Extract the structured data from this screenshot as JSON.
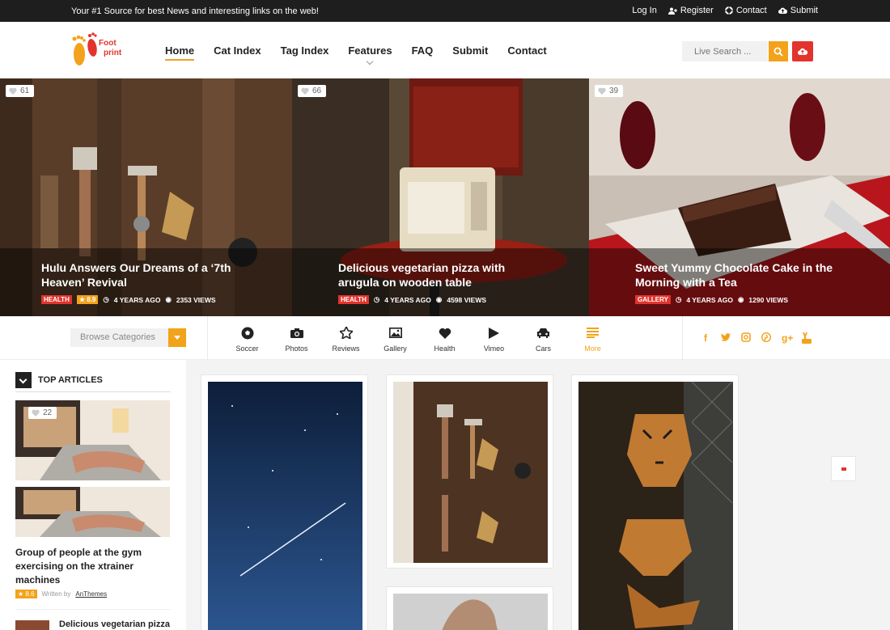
{
  "topbar": {
    "tagline": "Your #1 Source for best News and interesting links on the web!",
    "links": [
      {
        "label": "Log In",
        "icon": ""
      },
      {
        "label": "Register",
        "icon": "user-plus-icon"
      },
      {
        "label": "Contact",
        "icon": "lifebuoy-icon"
      },
      {
        "label": "Submit",
        "icon": "cloud-upload-icon"
      }
    ]
  },
  "logo": {
    "line1": "Foot",
    "line2": "print"
  },
  "nav": [
    {
      "label": "Home",
      "active": true
    },
    {
      "label": "Cat Index"
    },
    {
      "label": "Tag Index"
    },
    {
      "label": "Features",
      "has_dropdown": true
    },
    {
      "label": "FAQ"
    },
    {
      "label": "Submit"
    },
    {
      "label": "Contact"
    }
  ],
  "search": {
    "placeholder": "Live Search ..."
  },
  "hero": [
    {
      "likes": "61",
      "title": "Hulu Answers Our Dreams of a ‘7th Heaven’ Revival",
      "category": "HEALTH",
      "rating": "★ 8.9",
      "time": "4 YEARS AGO",
      "views": "2353 VIEWS"
    },
    {
      "likes": "66",
      "title": "Delicious vegetarian pizza with arugula on wooden table",
      "category": "HEALTH",
      "time": "4 YEARS AGO",
      "views": "4598 VIEWS"
    },
    {
      "likes": "39",
      "title": "Sweet Yummy Chocolate Cake in the Morning with a Tea",
      "category": "GALLERY",
      "time": "4 YEARS AGO",
      "views": "1290 VIEWS"
    }
  ],
  "browse": {
    "label": "Browse Categories"
  },
  "categories": [
    "Soccer",
    "Photos",
    "Reviews",
    "Gallery",
    "Health",
    "Vimeo",
    "Cars",
    "More"
  ],
  "social": [
    "facebook-icon",
    "twitter-icon",
    "instagram-icon",
    "pinterest-icon",
    "google-plus-icon",
    "youtube-icon"
  ],
  "sidebar": {
    "heading": "TOP ARTICLES",
    "likes": "22",
    "article_title": "Group of people at the gym exercising on the xtrainer machines",
    "rating": "★ 8.6",
    "written_by": "Written by",
    "author": "AnThemes",
    "next_title": "Delicious vegetarian pizza"
  },
  "colors": {
    "accent": "#f3a21b",
    "red": "#e2342d",
    "dark": "#1e1e1e"
  }
}
